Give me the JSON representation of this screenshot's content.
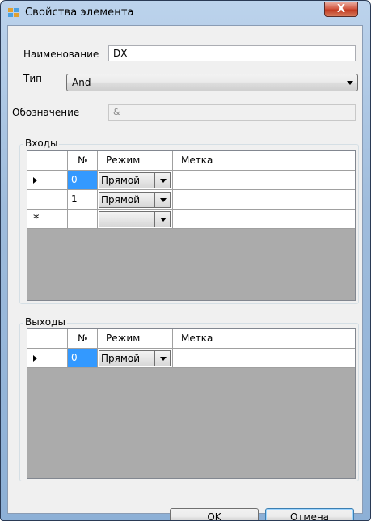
{
  "window": {
    "title": "Свойства элемента",
    "close_glyph": "X"
  },
  "form": {
    "name_label": "Наименование",
    "name_value": "DX",
    "type_label": "Тип",
    "type_value": "And",
    "designation_label": "Обозначение",
    "designation_value": "&"
  },
  "inputs": {
    "group_title": "Входы",
    "columns": [
      "№",
      "Режим",
      "Метка"
    ],
    "rows": [
      {
        "num": "0",
        "mode": "Прямой",
        "label": ""
      },
      {
        "num": "1",
        "mode": "Прямой",
        "label": ""
      }
    ],
    "new_row_glyph": "*"
  },
  "outputs": {
    "group_title": "Выходы",
    "columns": [
      "№",
      "Режим",
      "Метка"
    ],
    "rows": [
      {
        "num": "0",
        "mode": "Прямой",
        "label": ""
      }
    ]
  },
  "buttons": {
    "ok": "OK",
    "cancel": "Отмена"
  },
  "colors": {
    "selection": "#3399ff",
    "grid_bg": "#ababab"
  },
  "icons": {
    "app": "properties-window-icon",
    "close": "close-icon",
    "row_current": "current-row-arrow-icon",
    "row_new": "new-row-star-icon"
  }
}
